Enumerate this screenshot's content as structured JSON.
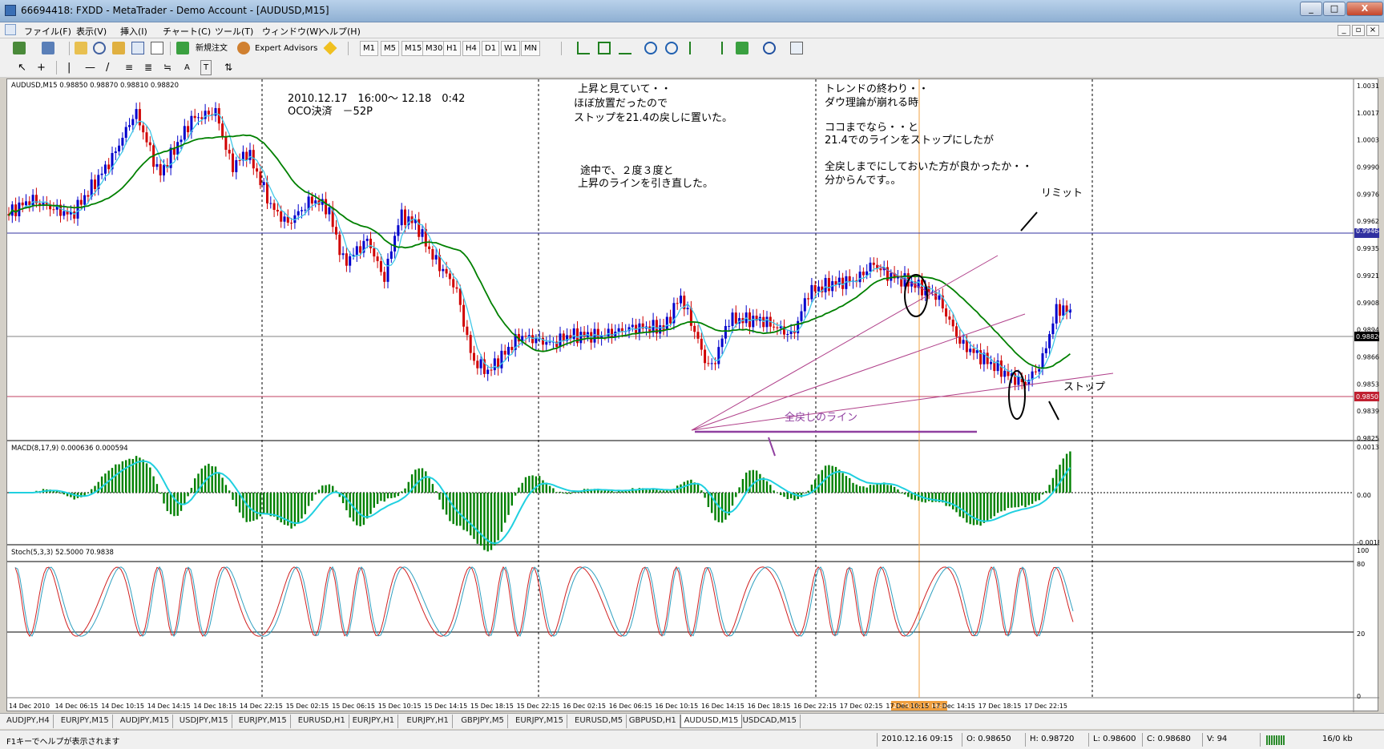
{
  "window": {
    "title": "66694418: FXDD - MetaTrader - Demo Account - [AUDUSD,M15]",
    "buttons": [
      "_",
      "□",
      "X"
    ]
  },
  "menu": [
    "ファイル(F)",
    "表示(V)",
    "挿入(I)",
    "チャート(C)",
    "ツール(T)",
    "ウィンドウ(W)",
    "ヘルプ(H)"
  ],
  "toolbar1": {
    "new_order": "新規注文",
    "expert_advisors": "Expert Advisors",
    "timeframes": [
      "M1",
      "M5",
      "M15",
      "M30",
      "H1",
      "H4",
      "D1",
      "W1",
      "MN"
    ]
  },
  "toolbar2": {
    "text_tool": "A",
    "label_tool": "T"
  },
  "chart": {
    "main_label": "AUDUSD,M15  0.98850 0.98870 0.98810 0.98820",
    "macd_label": "MACD(8,17,9) 0.000636 0.000594",
    "stoch_label": "Stoch(5,3,3) 52.5000 70.9838",
    "price_axis": [
      "1.00310",
      "1.00175",
      "1.00035",
      "0.99900",
      "0.99765",
      "0.99625",
      "0.99355",
      "0.99215",
      "0.99080",
      "0.98945",
      "0.98665",
      "0.98530",
      "0.98395",
      "0.98255"
    ],
    "price_highlight_blue": "0.99464",
    "price_highlight_black": "0.98820",
    "price_highlight_red": "0.98501",
    "macd_axis": [
      "0.001385",
      "0.00",
      "-0.00186"
    ],
    "stoch_axis": [
      "100",
      "80",
      "20",
      "0"
    ],
    "time_axis": [
      "14 Dec 2010",
      "14 Dec 06:15",
      "14 Dec 10:15",
      "14 Dec 14:15",
      "14 Dec 18:15",
      "14 Dec 22:15",
      "15 Dec 02:15",
      "15 Dec 06:15",
      "15 Dec 10:15",
      "15 Dec 14:15",
      "15 Dec 18:15",
      "15 Dec 22:15",
      "16 Dec 02:15",
      "16 Dec 06:15",
      "16 Dec 10:15",
      "16 Dec 14:15",
      "16 Dec 18:15",
      "16 Dec 22:15",
      "17 Dec 02:15",
      "17 Dec 10:15",
      "17 Dec 14:15",
      "17 Dec 18:15",
      "17 Dec 22:15"
    ],
    "time_highlight": "2010.12.17 09:00",
    "annotations": {
      "a1": [
        "2010.12.17　16:00～ 12.18　0:42",
        "OCO決済　－52P"
      ],
      "a2": [
        "上昇と見ていて・・",
        "ほぼ放置だったので",
        "ストップを21.4の戻しに置いた。"
      ],
      "a3": [
        "途中で、２度３度と",
        "上昇のラインを引き直した。"
      ],
      "a4": [
        "トレンドの終わり・・",
        "ダウ理論が崩れる時",
        "",
        "ココまでなら・・と",
        "21.4でのラインをストップにしたが",
        "",
        "全戻しまでにしておいた方が良かったか・・",
        "分からんです。。"
      ],
      "limit": "リミット",
      "stop": "ストップ",
      "full_retrace": "全戻しのライン"
    },
    "colors": {
      "bull": "#0000cc",
      "bear": "#d00000",
      "ma_fast": "#40c8e8",
      "ma_slow": "#008000",
      "macd_hist": "#008000",
      "signal": "#20d0e0",
      "fan": "#b0408a",
      "stoch_main": "#d02020",
      "stoch_signal": "#30a0c0"
    }
  },
  "tabs": [
    "AUDJPY,H4",
    "EURJPY,M15",
    "AUDJPY,M15",
    "USDJPY,M15",
    "EURJPY,M15",
    "EURUSD,H1",
    "EURJPY,H1",
    "EURJPY,H1",
    "GBPJPY,M5",
    "EURJPY,M15",
    "EURUSD,M5",
    "GBPUSD,H1",
    "AUDUSD,M15",
    "USDCAD,M15"
  ],
  "active_tab": 12,
  "status": {
    "help": "F1キーでヘルプが表示されます",
    "datetime": "2010.12.16 09:15",
    "open": "O: 0.98650",
    "high": "H: 0.98720",
    "low": "L: 0.98600",
    "close": "C: 0.98680",
    "volume": "V: 94",
    "traffic": "16/0 kb"
  }
}
